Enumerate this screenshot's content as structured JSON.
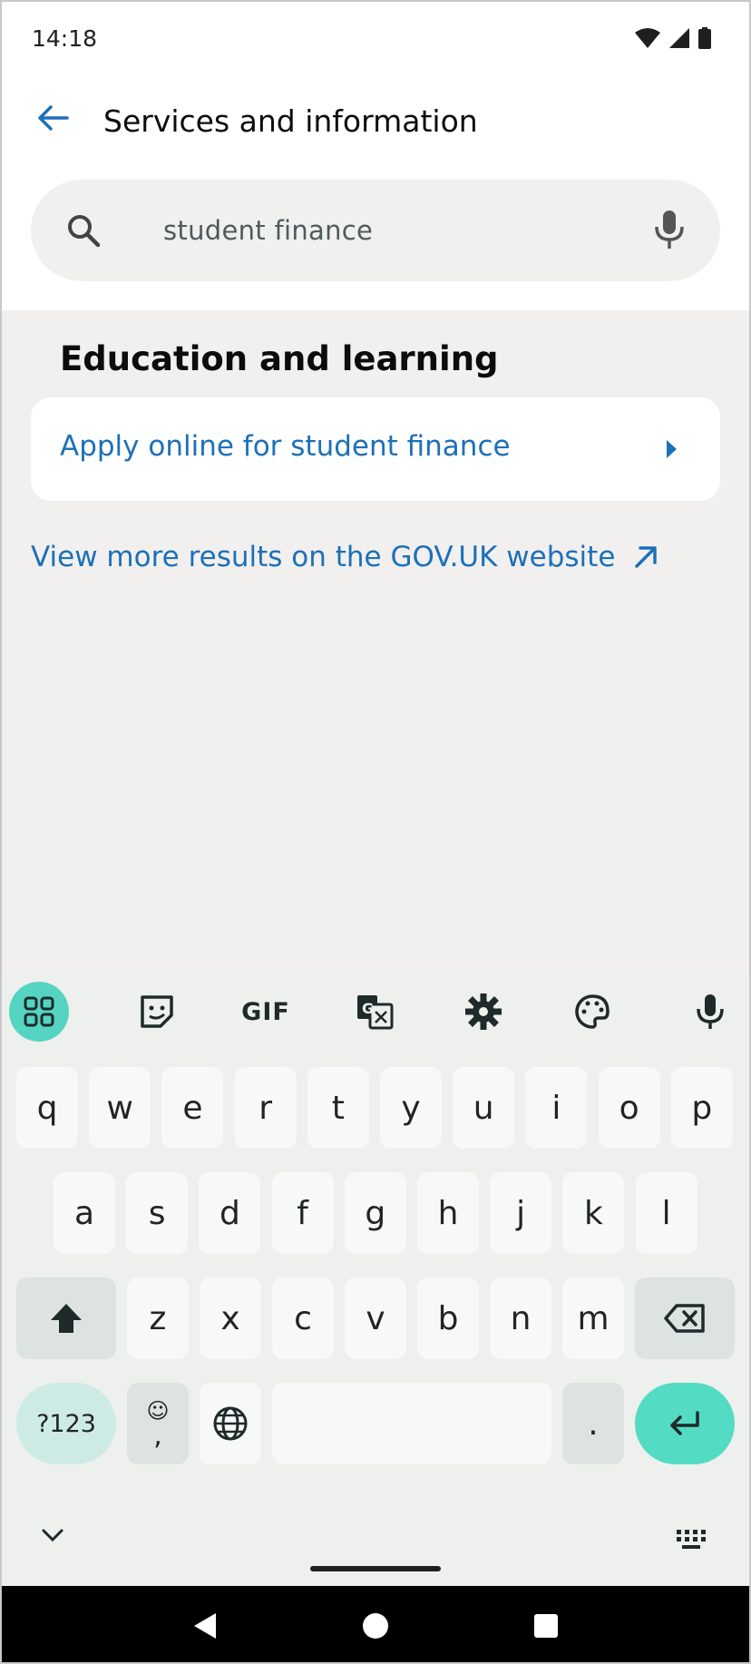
{
  "status_bar": {
    "time": "14:18",
    "icons": [
      "wifi-icon",
      "signal-icon",
      "battery-icon"
    ]
  },
  "app_bar": {
    "back_icon": "arrow-left-icon",
    "title": "Services and information"
  },
  "search": {
    "value": "student finance",
    "icon": "search-icon",
    "mic_icon": "microphone-icon"
  },
  "results": {
    "section_heading": "Education and learning",
    "items": [
      {
        "label": "Apply online for student finance",
        "icon": "chevron-right-icon"
      }
    ],
    "more_link": "View more results on the GOV.UK website",
    "more_link_icon": "external-arrow-icon"
  },
  "keyboard": {
    "toolbar": [
      "apps-grid-icon",
      "sticker-icon",
      "GIF",
      "translate-icon",
      "gear-icon",
      "palette-icon",
      "microphone-icon"
    ],
    "row1": [
      "q",
      "w",
      "e",
      "r",
      "t",
      "y",
      "u",
      "i",
      "o",
      "p"
    ],
    "row2": [
      "a",
      "s",
      "d",
      "f",
      "g",
      "h",
      "j",
      "k",
      "l"
    ],
    "row3": [
      "z",
      "x",
      "c",
      "v",
      "b",
      "n",
      "m"
    ],
    "symbols_key": "?123",
    "comma_key": ",",
    "period_key": ".",
    "collapse_icon": "chevron-down-icon",
    "switch_keyboard_icon": "keyboard-icon"
  },
  "colors": {
    "link_blue": "#1d70b8",
    "background": "#f1f0ee",
    "keyboard_accent": "#54dbc4"
  }
}
